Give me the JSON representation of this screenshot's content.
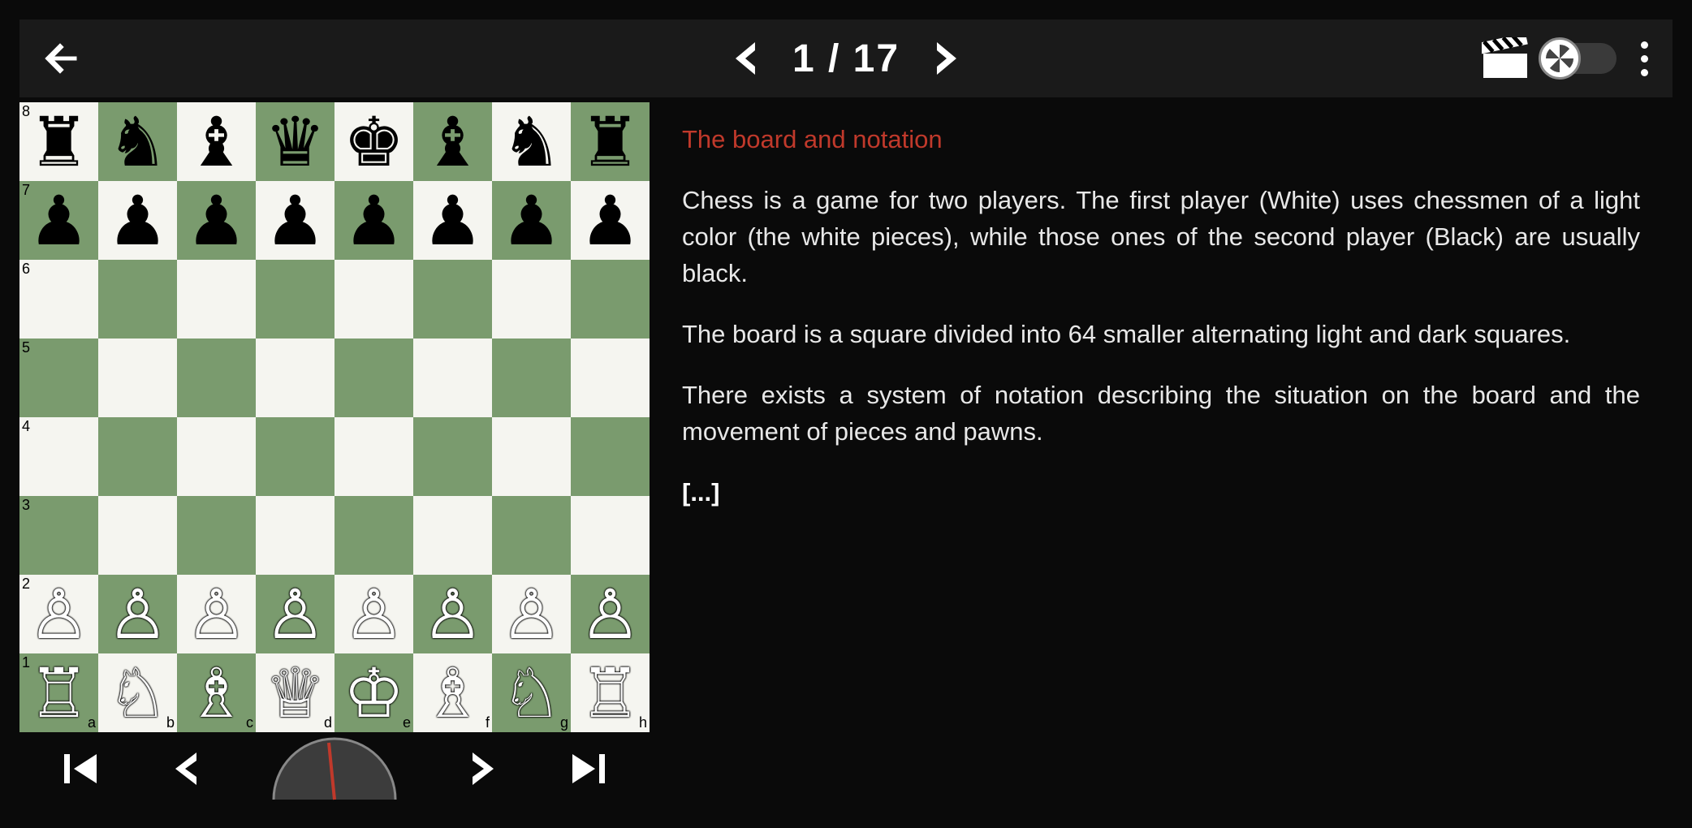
{
  "pager": {
    "current": 1,
    "total": 17,
    "display": "1 / 17"
  },
  "board": {
    "light_color": "#f5f5f0",
    "dark_color": "#7a9b6e",
    "rank_labels": [
      "8",
      "7",
      "6",
      "5",
      "4",
      "3",
      "2",
      "1"
    ],
    "file_labels": [
      "a",
      "b",
      "c",
      "d",
      "e",
      "f",
      "g",
      "h"
    ],
    "position_fen": "rnbqkbnr/pppppppp/8/8/8/8/PPPPPPPP/RNBQKBNR w KQkq - 0 1",
    "rows": [
      [
        {
          "file": "a",
          "rank": "8",
          "piece": "rook",
          "color": "black",
          "glyph": "♜"
        },
        {
          "file": "b",
          "rank": "8",
          "piece": "knight",
          "color": "black",
          "glyph": "♞"
        },
        {
          "file": "c",
          "rank": "8",
          "piece": "bishop",
          "color": "black",
          "glyph": "♝"
        },
        {
          "file": "d",
          "rank": "8",
          "piece": "queen",
          "color": "black",
          "glyph": "♛"
        },
        {
          "file": "e",
          "rank": "8",
          "piece": "king",
          "color": "black",
          "glyph": "♚"
        },
        {
          "file": "f",
          "rank": "8",
          "piece": "bishop",
          "color": "black",
          "glyph": "♝"
        },
        {
          "file": "g",
          "rank": "8",
          "piece": "knight",
          "color": "black",
          "glyph": "♞"
        },
        {
          "file": "h",
          "rank": "8",
          "piece": "rook",
          "color": "black",
          "glyph": "♜"
        }
      ],
      [
        {
          "file": "a",
          "rank": "7",
          "piece": "pawn",
          "color": "black",
          "glyph": "♟"
        },
        {
          "file": "b",
          "rank": "7",
          "piece": "pawn",
          "color": "black",
          "glyph": "♟"
        },
        {
          "file": "c",
          "rank": "7",
          "piece": "pawn",
          "color": "black",
          "glyph": "♟"
        },
        {
          "file": "d",
          "rank": "7",
          "piece": "pawn",
          "color": "black",
          "glyph": "♟"
        },
        {
          "file": "e",
          "rank": "7",
          "piece": "pawn",
          "color": "black",
          "glyph": "♟"
        },
        {
          "file": "f",
          "rank": "7",
          "piece": "pawn",
          "color": "black",
          "glyph": "♟"
        },
        {
          "file": "g",
          "rank": "7",
          "piece": "pawn",
          "color": "black",
          "glyph": "♟"
        },
        {
          "file": "h",
          "rank": "7",
          "piece": "pawn",
          "color": "black",
          "glyph": "♟"
        }
      ],
      [
        {
          "file": "a",
          "rank": "6",
          "piece": null
        },
        {
          "file": "b",
          "rank": "6",
          "piece": null
        },
        {
          "file": "c",
          "rank": "6",
          "piece": null
        },
        {
          "file": "d",
          "rank": "6",
          "piece": null
        },
        {
          "file": "e",
          "rank": "6",
          "piece": null
        },
        {
          "file": "f",
          "rank": "6",
          "piece": null
        },
        {
          "file": "g",
          "rank": "6",
          "piece": null
        },
        {
          "file": "h",
          "rank": "6",
          "piece": null
        }
      ],
      [
        {
          "file": "a",
          "rank": "5",
          "piece": null
        },
        {
          "file": "b",
          "rank": "5",
          "piece": null
        },
        {
          "file": "c",
          "rank": "5",
          "piece": null
        },
        {
          "file": "d",
          "rank": "5",
          "piece": null
        },
        {
          "file": "e",
          "rank": "5",
          "piece": null
        },
        {
          "file": "f",
          "rank": "5",
          "piece": null
        },
        {
          "file": "g",
          "rank": "5",
          "piece": null
        },
        {
          "file": "h",
          "rank": "5",
          "piece": null
        }
      ],
      [
        {
          "file": "a",
          "rank": "4",
          "piece": null
        },
        {
          "file": "b",
          "rank": "4",
          "piece": null
        },
        {
          "file": "c",
          "rank": "4",
          "piece": null
        },
        {
          "file": "d",
          "rank": "4",
          "piece": null
        },
        {
          "file": "e",
          "rank": "4",
          "piece": null
        },
        {
          "file": "f",
          "rank": "4",
          "piece": null
        },
        {
          "file": "g",
          "rank": "4",
          "piece": null
        },
        {
          "file": "h",
          "rank": "4",
          "piece": null
        }
      ],
      [
        {
          "file": "a",
          "rank": "3",
          "piece": null
        },
        {
          "file": "b",
          "rank": "3",
          "piece": null
        },
        {
          "file": "c",
          "rank": "3",
          "piece": null
        },
        {
          "file": "d",
          "rank": "3",
          "piece": null
        },
        {
          "file": "e",
          "rank": "3",
          "piece": null
        },
        {
          "file": "f",
          "rank": "3",
          "piece": null
        },
        {
          "file": "g",
          "rank": "3",
          "piece": null
        },
        {
          "file": "h",
          "rank": "3",
          "piece": null
        }
      ],
      [
        {
          "file": "a",
          "rank": "2",
          "piece": "pawn",
          "color": "white",
          "glyph": "♙"
        },
        {
          "file": "b",
          "rank": "2",
          "piece": "pawn",
          "color": "white",
          "glyph": "♙"
        },
        {
          "file": "c",
          "rank": "2",
          "piece": "pawn",
          "color": "white",
          "glyph": "♙"
        },
        {
          "file": "d",
          "rank": "2",
          "piece": "pawn",
          "color": "white",
          "glyph": "♙"
        },
        {
          "file": "e",
          "rank": "2",
          "piece": "pawn",
          "color": "white",
          "glyph": "♙"
        },
        {
          "file": "f",
          "rank": "2",
          "piece": "pawn",
          "color": "white",
          "glyph": "♙"
        },
        {
          "file": "g",
          "rank": "2",
          "piece": "pawn",
          "color": "white",
          "glyph": "♙"
        },
        {
          "file": "h",
          "rank": "2",
          "piece": "pawn",
          "color": "white",
          "glyph": "♙"
        }
      ],
      [
        {
          "file": "a",
          "rank": "1",
          "piece": "rook",
          "color": "white",
          "glyph": "♖"
        },
        {
          "file": "b",
          "rank": "1",
          "piece": "knight",
          "color": "white",
          "glyph": "♘"
        },
        {
          "file": "c",
          "rank": "1",
          "piece": "bishop",
          "color": "white",
          "glyph": "♗"
        },
        {
          "file": "d",
          "rank": "1",
          "piece": "queen",
          "color": "white",
          "glyph": "♕"
        },
        {
          "file": "e",
          "rank": "1",
          "piece": "king",
          "color": "white",
          "glyph": "♔"
        },
        {
          "file": "f",
          "rank": "1",
          "piece": "bishop",
          "color": "white",
          "glyph": "♗"
        },
        {
          "file": "g",
          "rank": "1",
          "piece": "knight",
          "color": "white",
          "glyph": "♘"
        },
        {
          "file": "h",
          "rank": "1",
          "piece": "rook",
          "color": "white",
          "glyph": "♖"
        }
      ]
    ]
  },
  "lesson": {
    "title": "The board and notation",
    "paragraphs": [
      "Chess is a game for two players. The first player (White) uses chessmen of a light color (the white pieces), while those ones of the second player (Black) are usually black.",
      "The board is a square divided into 64 smaller alternating light and dark squares.",
      "There exists a system of notation describing the situation on the board and the movement of pieces and pawns."
    ],
    "more": "[...]"
  },
  "toggle": {
    "enabled": false
  },
  "accent_color": "#c0392b"
}
